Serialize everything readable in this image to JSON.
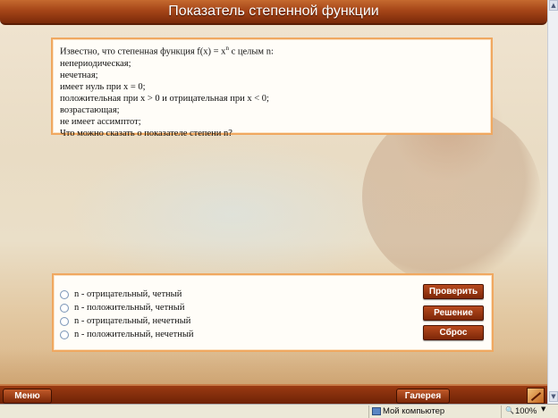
{
  "header": {
    "title": "Показатель степенной функции"
  },
  "question": {
    "line1_pre": "Известно, что степенная функция f(x) = x",
    "line1_sup": "n",
    "line1_post": " с целым n:",
    "lines": [
      "непериодическая;",
      "нечетная;",
      "имеет нуль при x = 0;",
      "положительная при x > 0 и отрицательная при x < 0;",
      "возрастающая;",
      "не имеет ассимптот;",
      "Что можно сказать о показателе степени n?"
    ]
  },
  "answers": {
    "options": [
      "n - отрицательный, четный",
      "n - положительный, четный",
      "n - отрицательный, нечетный",
      "n - положительный, нечетный"
    ],
    "check_label": "Проверить",
    "solution_label": "Решение",
    "reset_label": "Сброс"
  },
  "bottom_bar": {
    "menu_label": "Меню",
    "gallery_label": "Галерея"
  },
  "statusbar": {
    "zone": "Мой компьютер",
    "zoom": "100%"
  },
  "icons": [
    "pencil-icon",
    "computer-icon",
    "zoom-icon"
  ]
}
